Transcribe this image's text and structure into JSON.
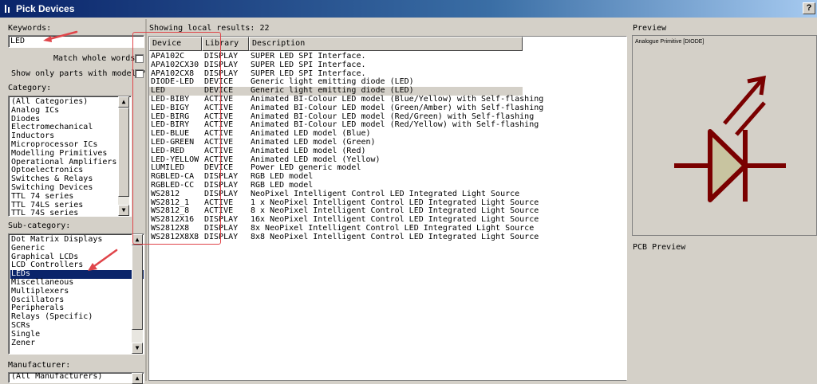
{
  "window": {
    "title": "Pick Devices",
    "help": "?"
  },
  "keywords": {
    "label": "Keywords:",
    "value": "LED"
  },
  "options": {
    "match_whole_words": "Match whole words?",
    "only_models": "Show only parts with models?"
  },
  "category": {
    "label": "Category:",
    "items": [
      "(All Categories)",
      "Analog ICs",
      "Diodes",
      "Electromechanical",
      "Inductors",
      "Microprocessor ICs",
      "Modelling Primitives",
      "Operational Amplifiers",
      "Optoelectronics",
      "Switches & Relays",
      "Switching Devices",
      "TTL 74 series",
      "TTL 74LS series",
      "TTL 74S series"
    ]
  },
  "subcategory": {
    "label": "Sub-category:",
    "items": [
      "Dot Matrix Displays",
      "Generic",
      "Graphical LCDs",
      "LCD Controllers",
      "LEDs",
      "Miscellaneous",
      "Multiplexers",
      "Oscillators",
      "Peripherals",
      "Relays (Specific)",
      "SCRs",
      "Single",
      "Zener"
    ],
    "selected": "LEDs"
  },
  "manufacturer": {
    "label": "Manufacturer:",
    "items": [
      "(All Manufacturers)"
    ]
  },
  "results": {
    "summary": "Showing local results: 22",
    "columns": [
      "Device",
      "Library",
      "Description"
    ],
    "selected": "LED",
    "rows": [
      [
        "APA102C",
        "DISPLAY",
        "SUPER LED SPI Interface."
      ],
      [
        "APA102CX30",
        "DISPLAY",
        "SUPER LED SPI Interface."
      ],
      [
        "APA102CX8",
        "DISPLAY",
        "SUPER LED SPI Interface."
      ],
      [
        "DIODE-LED",
        "DEVICE",
        "Generic light emitting diode (LED)"
      ],
      [
        "LED",
        "DEVICE",
        "Generic light emitting diode (LED)"
      ],
      [
        "LED-BIBY",
        "ACTIVE",
        "Animated BI-Colour LED model (Blue/Yellow) with Self-flashing"
      ],
      [
        "LED-BIGY",
        "ACTIVE",
        "Animated BI-Colour LED model (Green/Amber) with Self-flashing"
      ],
      [
        "LED-BIRG",
        "ACTIVE",
        "Animated BI-Colour LED model (Red/Green) with Self-flashing"
      ],
      [
        "LED-BIRY",
        "ACTIVE",
        "Animated BI-Colour LED model (Red/Yellow) with Self-flashing"
      ],
      [
        "LED-BLUE",
        "ACTIVE",
        "Animated LED model (Blue)"
      ],
      [
        "LED-GREEN",
        "ACTIVE",
        "Animated LED model (Green)"
      ],
      [
        "LED-RED",
        "ACTIVE",
        "Animated LED model (Red)"
      ],
      [
        "LED-YELLOW",
        "ACTIVE",
        "Animated LED model (Yellow)"
      ],
      [
        "LUMILED",
        "DEVICE",
        "Power LED generic model"
      ],
      [
        "RGBLED-CA",
        "DISPLAY",
        "RGB LED model"
      ],
      [
        "RGBLED-CC",
        "DISPLAY",
        "RGB LED model"
      ],
      [
        "WS2812",
        "DISPLAY",
        "NeoPixel Intelligent Control LED Integrated Light Source"
      ],
      [
        "WS2812_1",
        "ACTIVE",
        "1 x NeoPixel Intelligent Control LED Integrated Light Source"
      ],
      [
        "WS2812_8",
        "ACTIVE",
        "8 x NeoPixel Intelligent Control LED Integrated Light Source"
      ],
      [
        "WS2812X16",
        "DISPLAY",
        "16x NeoPixel Intelligent Control LED Integrated Light Source"
      ],
      [
        "WS2812X8",
        "DISPLAY",
        "8x NeoPixel Intelligent Control LED Integrated Light Source"
      ],
      [
        "WS2812X8X8",
        "DISPLAY",
        "8x8 NeoPixel Intelligent Control LED Integrated Light Source"
      ]
    ]
  },
  "preview": {
    "label": "Preview",
    "caption": "Analogue Primitive [DIODE]",
    "symbol_color": "#7a0000",
    "fill_color": "#c8c4a0"
  },
  "pcb_preview": {
    "label": "PCB Preview"
  },
  "annotation_color": "#e0454a"
}
